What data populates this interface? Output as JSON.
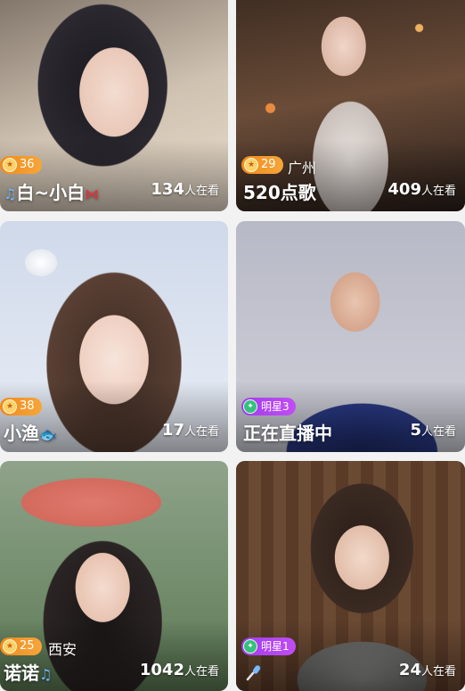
{
  "cards": [
    {
      "name": "白~小白",
      "level": "36",
      "viewers": "134",
      "viewers_unit": "人在看",
      "name_prefix_icon": "music-note-icon",
      "name_suffix_icon": "bow-icon"
    },
    {
      "name": "520点歌",
      "level": "29",
      "city": "广州",
      "viewers": "409",
      "viewers_unit": "人在看"
    },
    {
      "name": "小渔",
      "level": "38",
      "viewers": "17",
      "viewers_unit": "人在看",
      "name_suffix_icon": "fish-icon"
    },
    {
      "name": "正在直播中",
      "star_badge": "明星3",
      "viewers": "5",
      "viewers_unit": "人在看"
    },
    {
      "name": "诺诺",
      "level": "25",
      "city": "西安",
      "viewers": "1042",
      "viewers_unit": "人在看",
      "name_suffix_icon": "music-note-icon"
    },
    {
      "star_badge": "明星1",
      "viewers": "24",
      "viewers_unit": "人在看",
      "name_prefix_icon": "microphone-icon"
    }
  ],
  "colors": {
    "level_badge": "#f08a1c",
    "star_badge": "#a33cf0",
    "star_medal": "#35c07e"
  }
}
